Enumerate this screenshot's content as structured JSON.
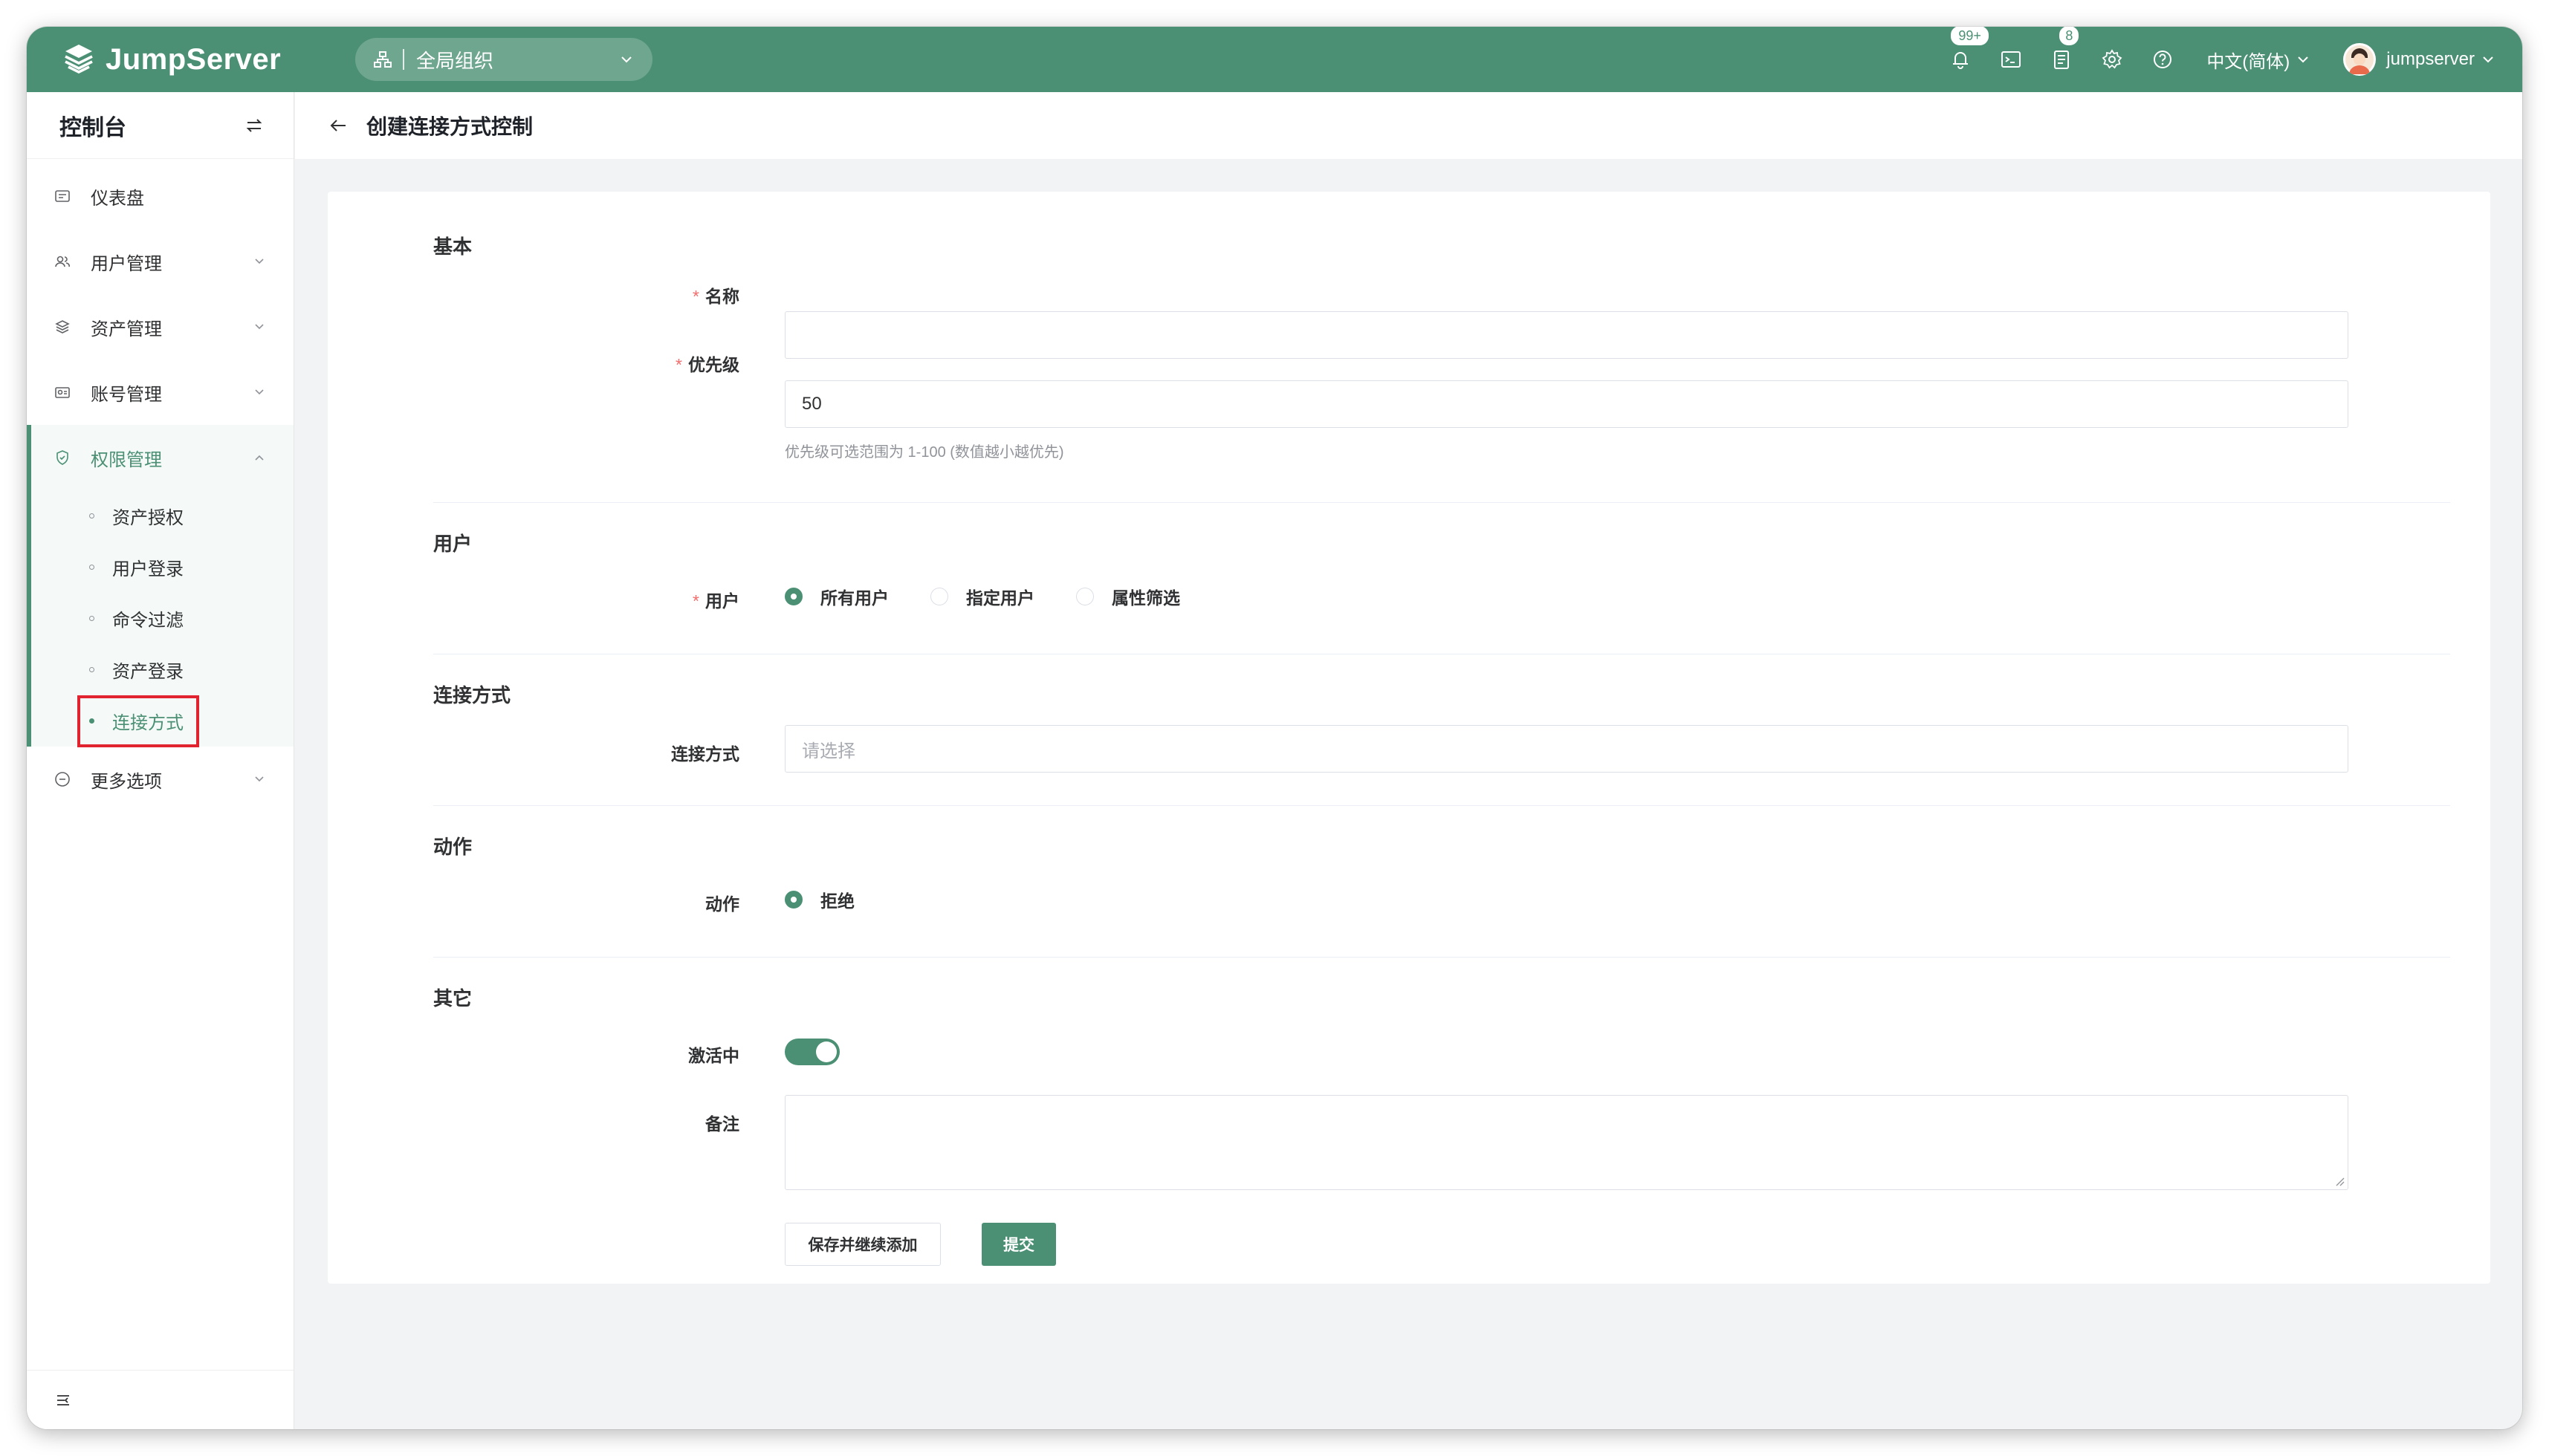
{
  "app": {
    "brand": "JumpServer",
    "org_label": "全局组织",
    "badges": {
      "notifications": "99+",
      "tickets": "8"
    },
    "language": "中文(简体)",
    "username": "jumpserver"
  },
  "sidebar": {
    "title": "控制台",
    "items": [
      {
        "label": "仪表盘",
        "icon": "dashboard-icon"
      },
      {
        "label": "用户管理",
        "icon": "users-icon"
      },
      {
        "label": "资产管理",
        "icon": "assets-icon"
      },
      {
        "label": "账号管理",
        "icon": "accounts-icon"
      },
      {
        "label": "权限管理",
        "icon": "shield-icon"
      },
      {
        "label": "更多选项",
        "icon": "more-icon"
      }
    ],
    "sub_items": [
      "资产授权",
      "用户登录",
      "命令过滤",
      "资产登录",
      "连接方式"
    ]
  },
  "page": {
    "title": "创建连接方式控制"
  },
  "form": {
    "sections": {
      "basic": "基本",
      "user": "用户",
      "connect": "连接方式",
      "action": "动作",
      "other": "其它"
    },
    "name_label": "名称",
    "name_value": "",
    "priority_label": "优先级",
    "priority_value": "50",
    "priority_hint": "优先级可选范围为 1-100 (数值越小越优先)",
    "user_label": "用户",
    "user_options": [
      "所有用户",
      "指定用户",
      "属性筛选"
    ],
    "user_selected": "所有用户",
    "connect_label": "连接方式",
    "connect_placeholder": "请选择",
    "action_label": "动作",
    "action_option": "拒绝",
    "active_label": "激活中",
    "active_value": true,
    "comment_label": "备注",
    "btn_save_continue": "保存并继续添加",
    "btn_submit": "提交"
  },
  "colors": {
    "brand": "#4b9074",
    "required": "#f56c6c",
    "highlight": "#e0232f"
  }
}
